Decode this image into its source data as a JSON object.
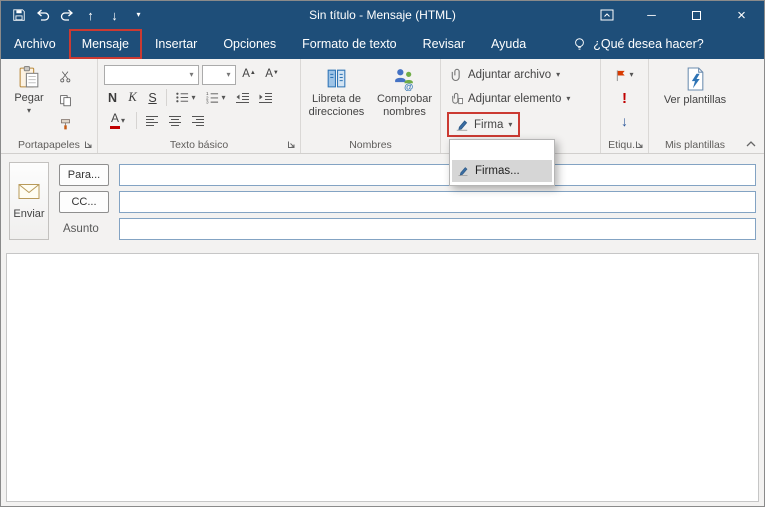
{
  "window": {
    "title": "Sin título - Mensaje (HTML)"
  },
  "glyphs": {
    "up_arrow": "↑",
    "down_arrow": "↓",
    "caret_down": "▾",
    "tri_up": "▲",
    "tri_down": "▼",
    "minimize": "─",
    "close": "×"
  },
  "tabs": [
    {
      "label": "Archivo"
    },
    {
      "label": "Mensaje",
      "active": true
    },
    {
      "label": "Insertar"
    },
    {
      "label": "Opciones"
    },
    {
      "label": "Formato de texto"
    },
    {
      "label": "Revisar"
    },
    {
      "label": "Ayuda"
    }
  ],
  "tell_me": {
    "label": "¿Qué desea hacer?"
  },
  "ribbon": {
    "clipboard": {
      "label": "Portapapeles",
      "paste": "Pegar"
    },
    "basic_text": {
      "label": "Texto básico",
      "font_name_value": "",
      "font_size_value": "",
      "bold": "N",
      "italic": "K",
      "underline": "S",
      "grow_font": "A",
      "shrink_font": "A",
      "font_color": "A"
    },
    "names": {
      "label": "Nombres",
      "address_book": "Libreta de direcciones",
      "check_names": "Comprobar nombres"
    },
    "include": {
      "attach_file": "Adjuntar archivo",
      "attach_item": "Adjuntar elemento",
      "signature": "Firma"
    },
    "tags": {
      "label": "Etiqu...",
      "high_importance": "!",
      "low_importance": "↓"
    },
    "templates": {
      "label": "Mis plantillas",
      "view_templates": "Ver plantillas"
    },
    "signature_menu": {
      "items": [
        {
          "label": "Firmas..."
        }
      ]
    }
  },
  "compose": {
    "send": "Enviar",
    "to_button": "Para...",
    "cc_button": "CC...",
    "subject_label": "Asunto",
    "to_value": "",
    "cc_value": "",
    "subject_value": ""
  },
  "colors": {
    "titlebar": "#1e4e79",
    "annotation_red": "#cb3a32",
    "ribbon_bg": "#f3f2f1",
    "field_border": "#83a3c3"
  }
}
